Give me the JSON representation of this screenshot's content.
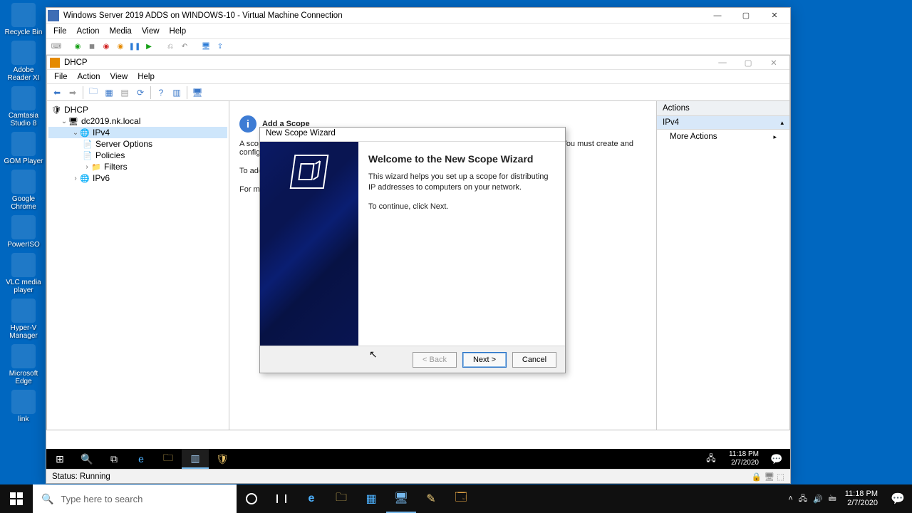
{
  "host": {
    "desktop_icons": [
      "Recycle Bin",
      "Adobe Reader XI",
      "Camtasia Studio 8",
      "GOM Player",
      "Google Chrome",
      "PowerISO",
      "VLC media player",
      "Hyper-V Manager",
      "Microsoft Edge",
      "link"
    ],
    "search_placeholder": "Type here to search",
    "time": "11:18 PM",
    "date": "2/7/2020"
  },
  "vm_window": {
    "title": "Windows Server 2019 ADDS on WINDOWS-10 - Virtual Machine Connection",
    "menu": [
      "File",
      "Action",
      "Media",
      "View",
      "Help"
    ],
    "status": "Status: Running"
  },
  "mmc": {
    "title": "DHCP",
    "menu": [
      "File",
      "Action",
      "View",
      "Help"
    ],
    "tree": {
      "root": "DHCP",
      "server": "dc2019.nk.local",
      "ipv4": "IPv4",
      "children": [
        "Server Options",
        "Policies",
        "Filters"
      ],
      "ipv6": "IPv6"
    },
    "info": {
      "heading": "Add a Scope",
      "p1": "A scope is a range of IP addresses assigned to computers requesting a dynamic IP address. You must create and configure a scope before dynamic IP addresses can be assigned.",
      "p2": "To add a new scope, on the Action menu, click New Scope.",
      "p3": "For more information about setting up a DHCP server, see online Help."
    },
    "actions": {
      "header": "Actions",
      "group": "IPv4",
      "more": "More Actions"
    },
    "inner_time": "11:18 PM",
    "inner_date": "2/7/2020"
  },
  "wizard": {
    "title": "New Scope Wizard",
    "heading": "Welcome to the New Scope Wizard",
    "desc": "This wizard helps you set up a scope for distributing IP addresses to computers on your network.",
    "cont": "To continue, click Next.",
    "back": "< Back",
    "next": "Next >",
    "cancel": "Cancel"
  }
}
